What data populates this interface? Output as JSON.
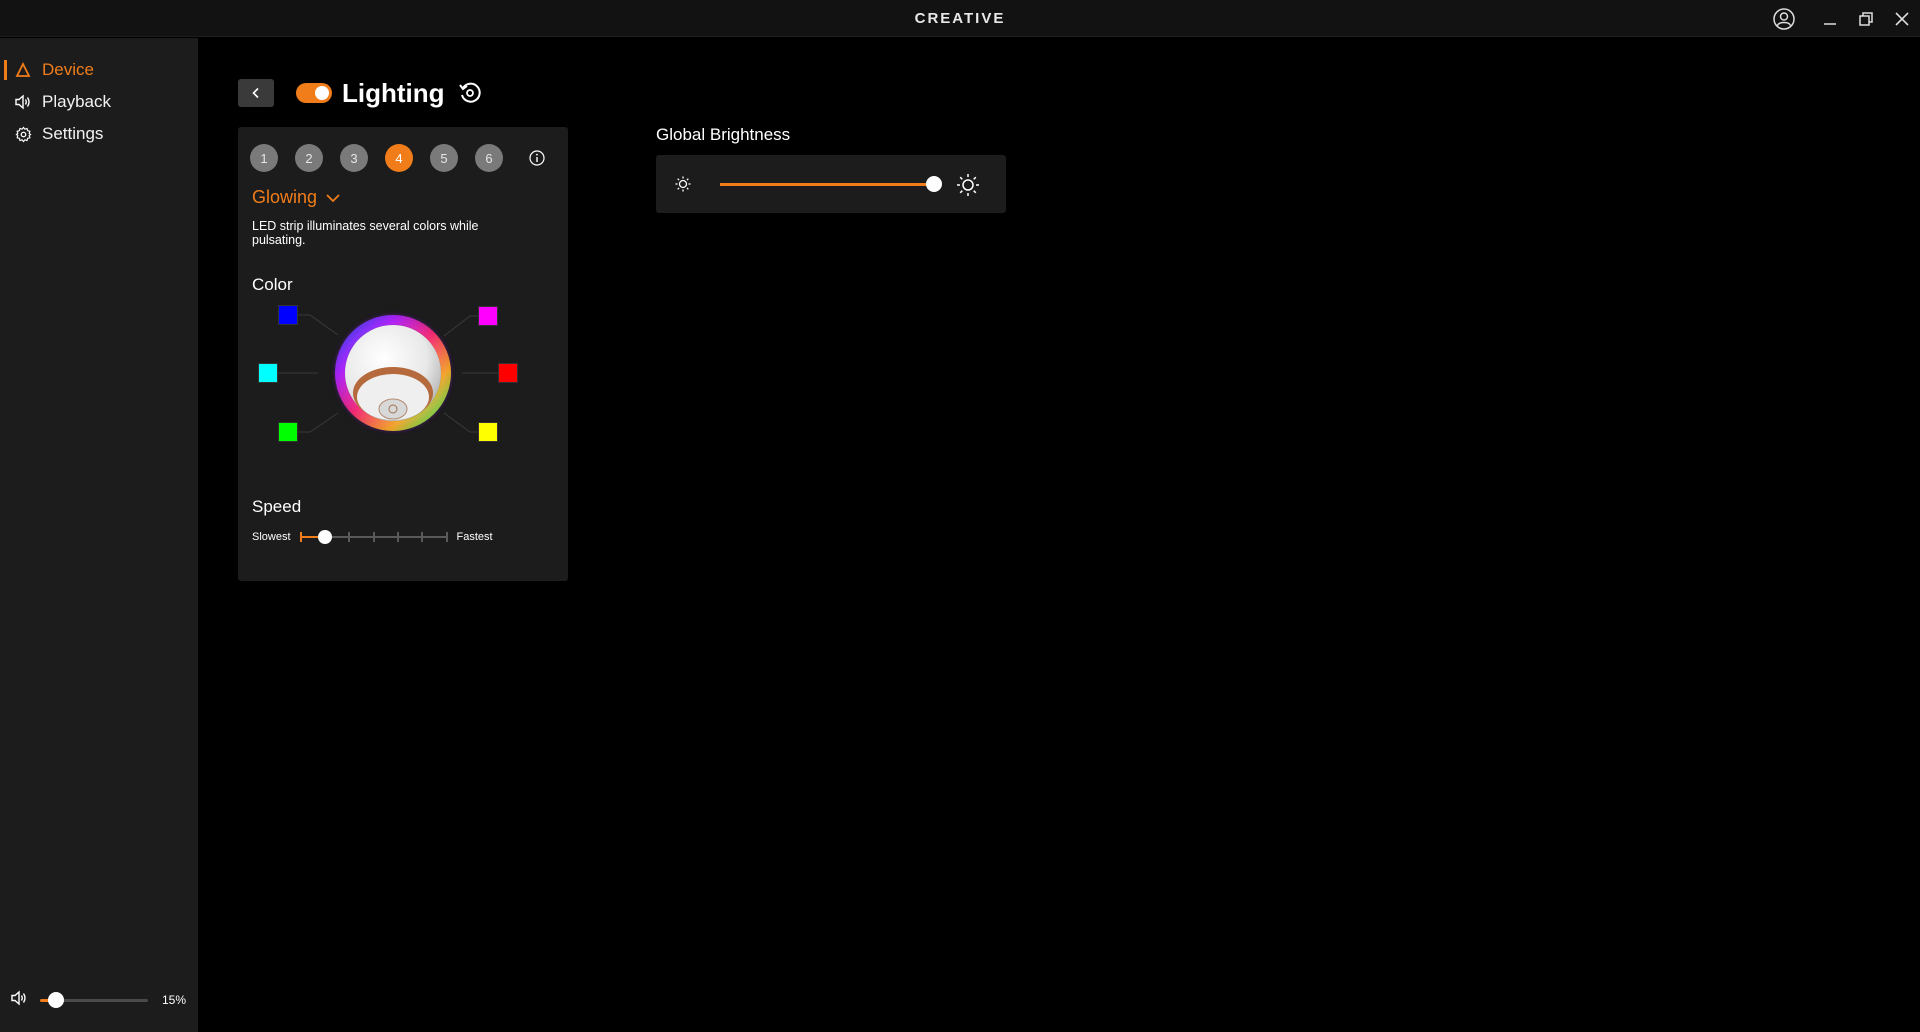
{
  "app": {
    "brand": "CREATIVE"
  },
  "window_controls": {
    "account_icon": "user-circle-icon",
    "minimize_icon": "minimize-icon",
    "restore_icon": "restore-icon",
    "close_icon": "close-icon"
  },
  "sidebar": {
    "items": [
      {
        "label": "Device",
        "icon": "device-triangle-icon",
        "active": true
      },
      {
        "label": "Playback",
        "icon": "speaker-icon",
        "active": false
      },
      {
        "label": "Settings",
        "icon": "gear-icon",
        "active": false
      }
    ],
    "volume": {
      "icon": "speaker-icon",
      "level": 0.15,
      "label": "15%"
    }
  },
  "header": {
    "title": "Lighting",
    "enabled": true,
    "back_icon": "chevron-left-icon",
    "reset_icon": "reset-icon"
  },
  "panel": {
    "presets": [
      "1",
      "2",
      "3",
      "4",
      "5",
      "6"
    ],
    "active_preset": "4",
    "info_icon": "info-icon",
    "effect": "Glowing",
    "description": "LED strip illuminates several colors while pulsating.",
    "color_label": "Color",
    "colors": [
      {
        "name": "blue",
        "hex": "#0000ff"
      },
      {
        "name": "magenta",
        "hex": "#ff00ff"
      },
      {
        "name": "cyan",
        "hex": "#00ffff"
      },
      {
        "name": "red",
        "hex": "#ff0000"
      },
      {
        "name": "green",
        "hex": "#00ff00"
      },
      {
        "name": "yellow",
        "hex": "#ffff00"
      }
    ],
    "speed": {
      "label": "Speed",
      "min_label": "Slowest",
      "max_label": "Fastest",
      "steps": 7,
      "value_step": 1
    }
  },
  "global_brightness": {
    "label": "Global Brightness",
    "level": 1.0
  },
  "accent_color": "#f07d19"
}
